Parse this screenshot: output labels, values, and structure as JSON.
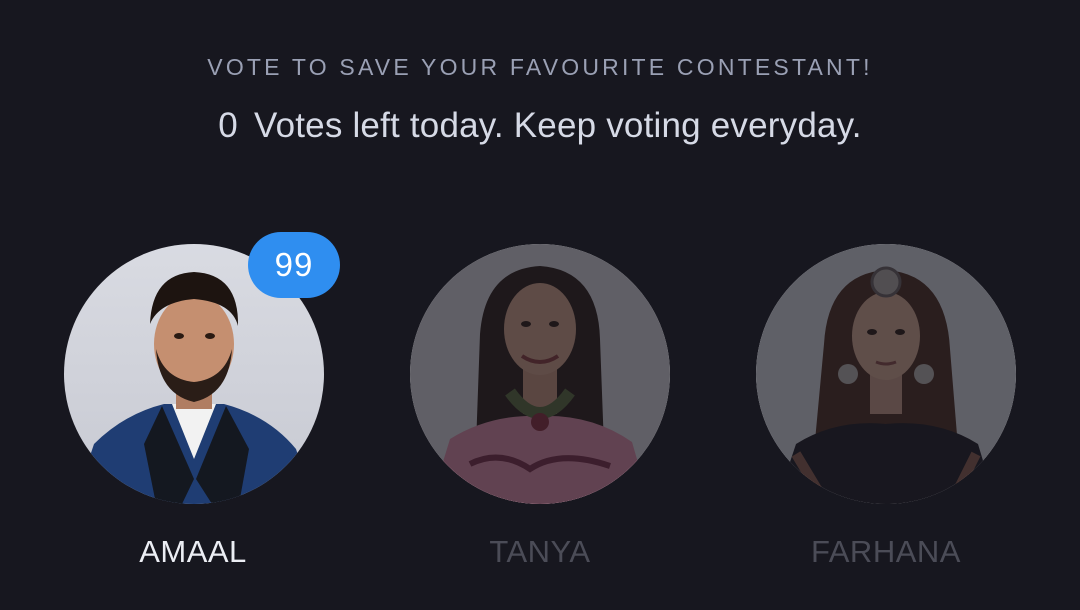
{
  "heading": "VOTE TO SAVE YOUR FAVOURITE CONTESTANT!",
  "votes": {
    "count": "0",
    "message": "Votes left today. Keep voting everyday."
  },
  "contestants": [
    {
      "name": "AMAAL",
      "badge": "99",
      "selected": true
    },
    {
      "name": "TANYA",
      "selected": false
    },
    {
      "name": "FARHANA",
      "selected": false
    }
  ],
  "colors": {
    "background": "#17171f",
    "badge": "#2f8ef0",
    "active_name": "#eceef4",
    "inactive_name": "#4b4c57"
  }
}
